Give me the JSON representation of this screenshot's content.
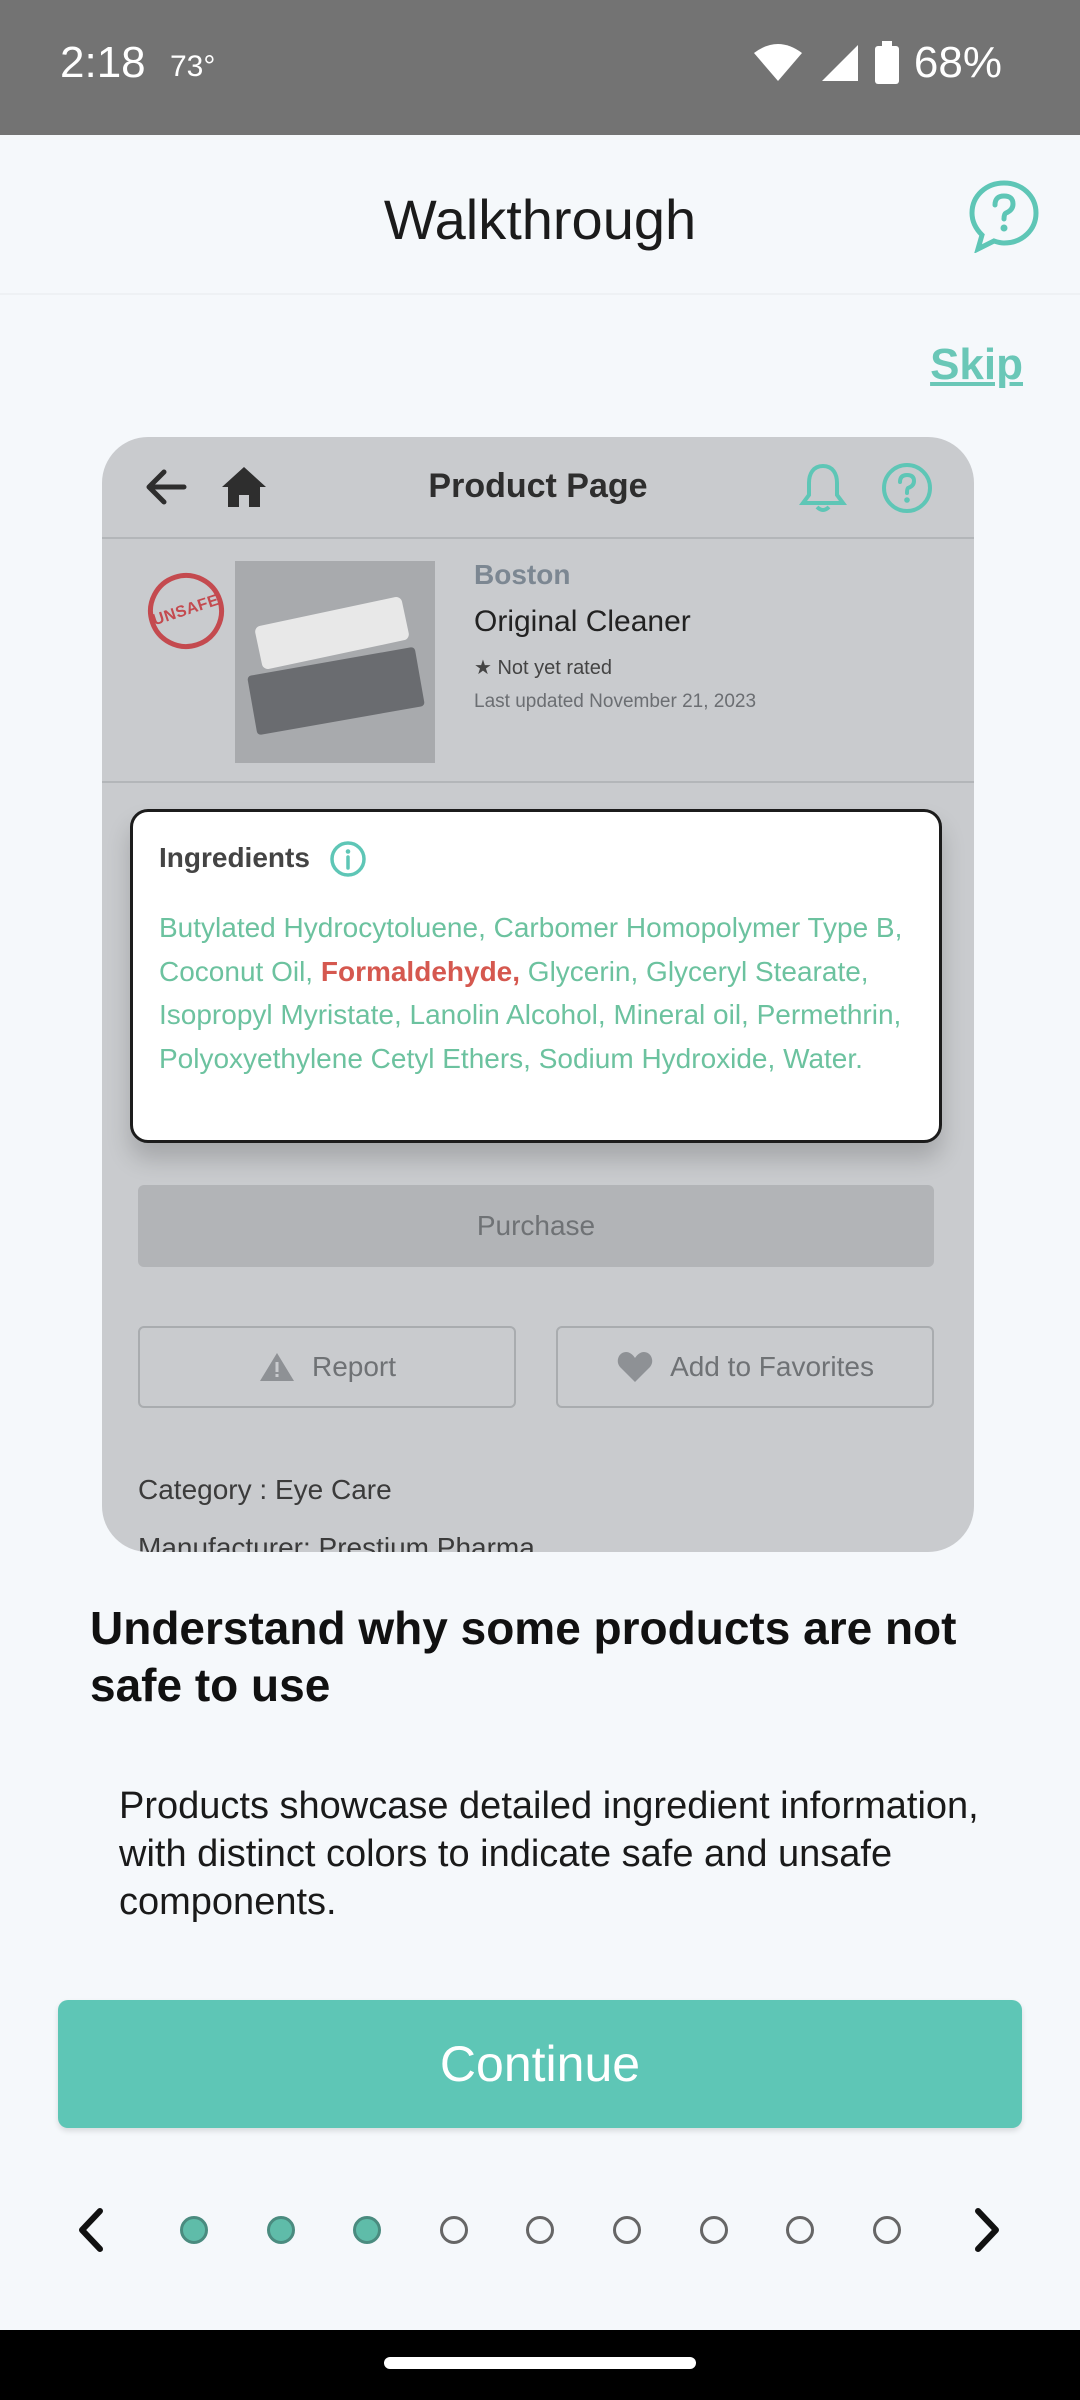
{
  "status_bar": {
    "time": "2:18",
    "temperature": "73°",
    "battery": "68%"
  },
  "header": {
    "title": "Walkthrough"
  },
  "skip_label": "Skip",
  "preview": {
    "page_title": "Product Page",
    "unsafe_badge": "UNSAFE",
    "brand": "Boston",
    "product_name": "Original Cleaner",
    "rating": "★ Not yet rated",
    "last_updated": "Last updated  November 21, 2023",
    "ingredients_heading": "Ingredients",
    "ingredients_before": "Butylated Hydrocytoluene, Carbomer Homopolymer Type B, Coconut Oil, ",
    "ingredients_flagged": "Formaldehyde,",
    "ingredients_after": " Glycerin, Glyceryl Stearate, Isopropyl Myristate, Lanolin Alcohol, Mineral oil, Permethrin, Polyoxyethylene Cetyl Ethers, Sodium Hydroxide, Water.",
    "purchase_label": "Purchase",
    "report_label": "Report",
    "favorites_label": "Add to Favorites",
    "category": "Category : Eye Care",
    "manufacturer": "Manufacturer: Prestium Pharma"
  },
  "headline": "Understand why some products are not safe to use",
  "description": "Products showcase detailed ingredient information, with distinct colors to indicate safe and unsafe components.",
  "continue_label": "Continue",
  "pager": {
    "total_pages": 9,
    "completed_pages": 3
  },
  "colors": {
    "accent": "#5ec6b6",
    "safe_green": "#6cc29f",
    "unsafe_red": "#d5584f"
  }
}
